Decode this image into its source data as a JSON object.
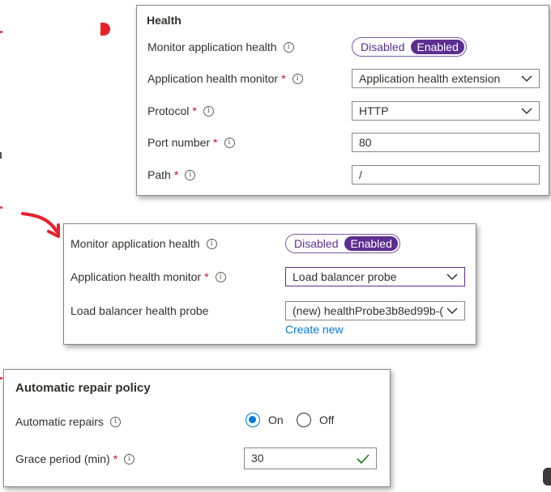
{
  "health": {
    "title": "Health",
    "monitor_label": "Monitor application health",
    "toggle_off": "Disabled",
    "toggle_on": "Enabled",
    "monitor_type_label": "Application health monitor",
    "monitor_type_value": "Application health extension",
    "protocol_label": "Protocol",
    "protocol_value": "HTTP",
    "port_label": "Port number",
    "port_value": "80",
    "path_label": "Path",
    "path_value": "/"
  },
  "lb": {
    "monitor_label": "Monitor application health",
    "toggle_off": "Disabled",
    "toggle_on": "Enabled",
    "monitor_type_label": "Application health monitor",
    "monitor_type_value": "Load balancer probe",
    "probe_label": "Load balancer health probe",
    "probe_value": "(new) healthProbe3b8ed99b-(",
    "create_new": "Create new"
  },
  "repair": {
    "title": "Automatic repair policy",
    "repairs_label": "Automatic repairs",
    "on_label": "On",
    "off_label": "Off",
    "selected": "On",
    "grace_label": "Grace period (min)",
    "grace_value": "30"
  },
  "required_mark": "*",
  "info_glyph": "i",
  "colors": {
    "accent": "#5c2e91",
    "link": "#0078d4",
    "required": "#c50f1f",
    "valid": "#107c10",
    "annotation": "#e8202a"
  }
}
